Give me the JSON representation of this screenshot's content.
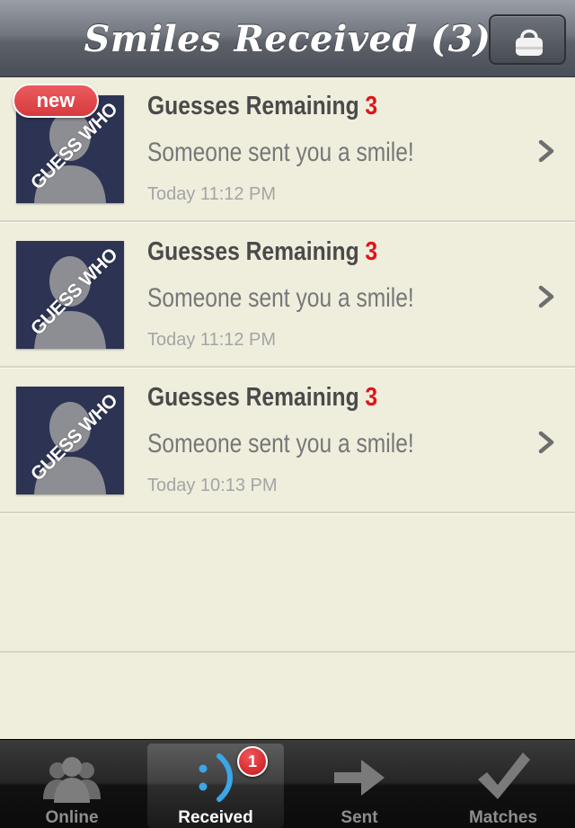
{
  "header": {
    "title": "Smiles Received (3)",
    "profile_icon": "profile-bag-icon"
  },
  "messages": [
    {
      "is_new": true,
      "new_label": "new",
      "thumb_stamp": "GUESS WHO",
      "guesses_label": "Guesses Remaining",
      "guesses_count": "3",
      "text": "Someone sent you a smile!",
      "time": "Today 11:12 PM"
    },
    {
      "is_new": false,
      "thumb_stamp": "GUESS WHO",
      "guesses_label": "Guesses Remaining",
      "guesses_count": "3",
      "text": "Someone sent you a smile!",
      "time": "Today 11:12 PM"
    },
    {
      "is_new": false,
      "thumb_stamp": "GUESS WHO",
      "guesses_label": "Guesses Remaining",
      "guesses_count": "3",
      "text": "Someone sent you a smile!",
      "time": "Today 10:13 PM"
    }
  ],
  "tabs": [
    {
      "label": "Online",
      "icon": "people-icon",
      "active": false
    },
    {
      "label": "Received",
      "icon": "smiley-icon",
      "active": true,
      "badge": "1"
    },
    {
      "label": "Sent",
      "icon": "arrow-right-icon",
      "active": false
    },
    {
      "label": "Matches",
      "icon": "checkmark-icon",
      "active": false
    }
  ],
  "colors": {
    "accent_red": "#e0141b",
    "background": "#efeedd",
    "smiley_blue": "#39a7e8"
  }
}
